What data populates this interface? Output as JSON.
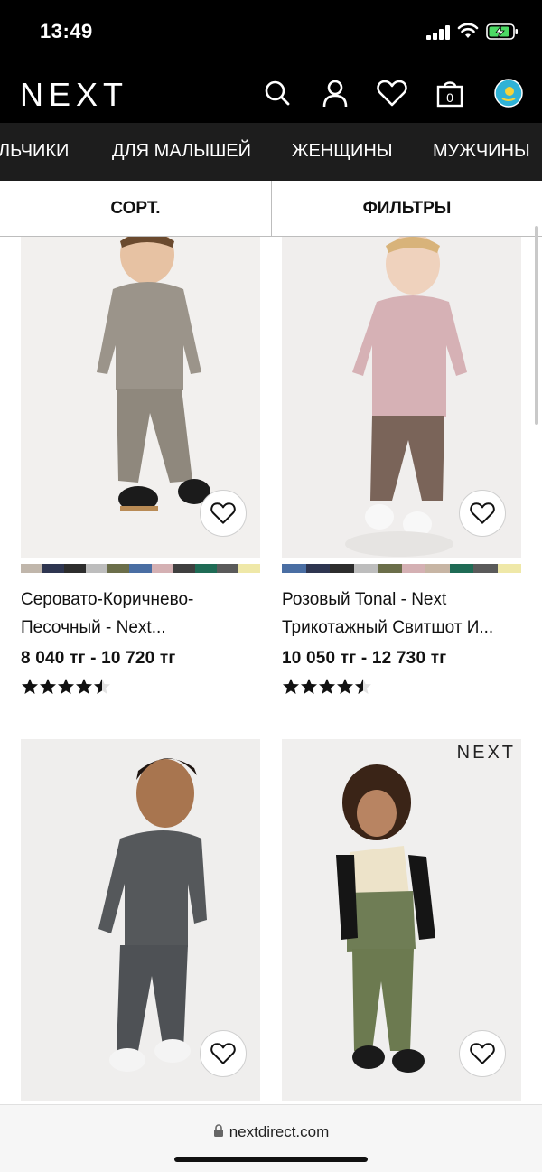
{
  "status_bar": {
    "time": "13:49"
  },
  "header": {
    "logo": "NEXT"
  },
  "categories": [
    "ЛЬЧИКИ",
    "ДЛЯ МАЛЫШЕЙ",
    "ЖЕНЩИНЫ",
    "МУЖЧИНЫ"
  ],
  "toolbar": {
    "sort_label": "СОРТ.",
    "filter_label": "ФИЛЬТРЫ"
  },
  "products": [
    {
      "name_line1": "Серовато-Коричнево-",
      "name_line2": "Песочный - Next...",
      "price": "8 040 тг - 10 720 тг",
      "rating": 4.5,
      "swatches": [
        "#c0b6ab",
        "#2e3550",
        "#2d2d2d",
        "#bdbdbd",
        "#6b6e4a",
        "#4a6ea3",
        "#d4b0b3",
        "#3f3f3f",
        "#1f6b55",
        "#5a5a5a",
        "#efe8a8"
      ]
    },
    {
      "name_line1": "Розовый Tonal - Next",
      "name_line2": "Трикотажный Свитшот И...",
      "price": "10 050 тг - 12 730 тг",
      "rating": 4.5,
      "swatches": [
        "#4a6ea3",
        "#2e3550",
        "#2d2d2d",
        "#bdbdbd",
        "#6b6e4a",
        "#d4b0b3",
        "#c7b5a4",
        "#1f6b55",
        "#5a5a5a",
        "#efe8a8"
      ]
    },
    {
      "name_line1": "",
      "name_line2": "",
      "price": "",
      "rating": 0,
      "swatches": [
        "#2d2d2d",
        "#2d2d2d",
        "#bdbdbd",
        "#c0b6ab",
        "#6b6e4a",
        "#d4b0b3",
        "#1f6b55",
        "#efe8a8"
      ]
    },
    {
      "name_line1": "",
      "name_line2": "",
      "price": "",
      "rating": 0,
      "brand_mark": "NEXT",
      "swatches": [
        "#6b6e4a",
        "#8ad3c3"
      ]
    }
  ],
  "browser": {
    "url": "nextdirect.com"
  }
}
